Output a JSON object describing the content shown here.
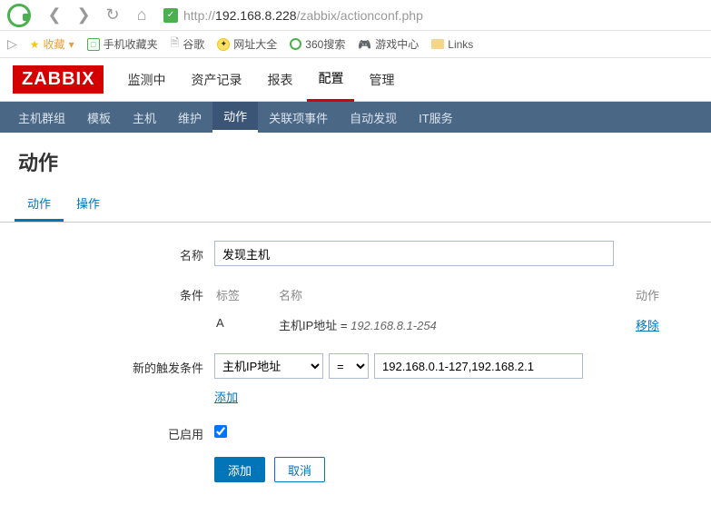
{
  "browser": {
    "url_prefix": "http://",
    "url_host": "192.168.8.228",
    "url_path": "/zabbix/actionconf.php"
  },
  "bookmarks": {
    "favorites": "收藏",
    "mobile": "手机收藏夹",
    "google": "谷歌",
    "wzdq": "网址大全",
    "search360": "360搜索",
    "gamecenter": "游戏中心",
    "links": "Links"
  },
  "zabbix": {
    "logo": "ZABBIX",
    "menu": {
      "monitoring": "监测中",
      "inventory": "资产记录",
      "reports": "报表",
      "configuration": "配置",
      "administration": "管理"
    },
    "submenu": {
      "hostgroups": "主机群组",
      "templates": "模板",
      "hosts": "主机",
      "maintenance": "维护",
      "actions": "动作",
      "correlation": "关联项事件",
      "discovery": "自动发现",
      "itservices": "IT服务"
    }
  },
  "page": {
    "title": "动作",
    "tabs": {
      "action": "动作",
      "operations": "操作"
    }
  },
  "form": {
    "labels": {
      "name": "名称",
      "conditions": "条件",
      "new_condition": "新的触发条件",
      "enabled": "已启用"
    },
    "name_value": "发现主机",
    "cond_headers": {
      "label": "标签",
      "name": "名称",
      "action": "动作"
    },
    "cond_row": {
      "label": "A",
      "name_prefix": "主机IP地址 = ",
      "name_value": "192.168.8.1-254",
      "remove": "移除"
    },
    "new_cond": {
      "type_selected": "主机IP地址",
      "op_selected": "=",
      "value": "192.168.0.1-127,192.168.2.1",
      "add": "添加"
    },
    "buttons": {
      "add": "添加",
      "cancel": "取消"
    }
  }
}
